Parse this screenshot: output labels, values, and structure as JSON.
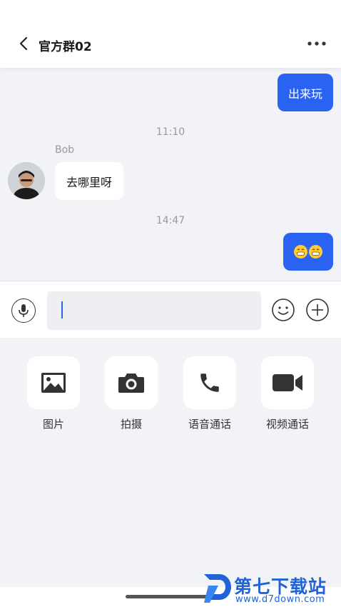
{
  "header": {
    "title": "官方群02",
    "back_icon": "chevron-left-icon",
    "more_icon": "more-horizontal-icon"
  },
  "messages": [
    {
      "direction": "out",
      "text": "出来玩"
    },
    {
      "time": "11:10"
    },
    {
      "direction": "in",
      "sender": "Bob",
      "text": "去哪里呀"
    },
    {
      "time": "14:47"
    },
    {
      "direction": "out",
      "emoji": "😁😁"
    }
  ],
  "input": {
    "value": "",
    "voice_icon": "microphone-icon",
    "emoji_icon": "smiley-icon",
    "plus_icon": "plus-circle-icon"
  },
  "panel": {
    "tools": [
      {
        "label": "图片",
        "icon": "image-icon"
      },
      {
        "label": "拍摄",
        "icon": "camera-icon"
      },
      {
        "label": "语音通话",
        "icon": "phone-icon"
      },
      {
        "label": "视频通话",
        "icon": "video-camera-icon"
      }
    ]
  },
  "watermark": {
    "title": "第七下载站",
    "url": "www.d7down.com"
  },
  "colors": {
    "accent": "#2a62f2",
    "background": "#f2f3f7",
    "bubble_in": "#ffffff",
    "watermark": "#1f63d6"
  }
}
